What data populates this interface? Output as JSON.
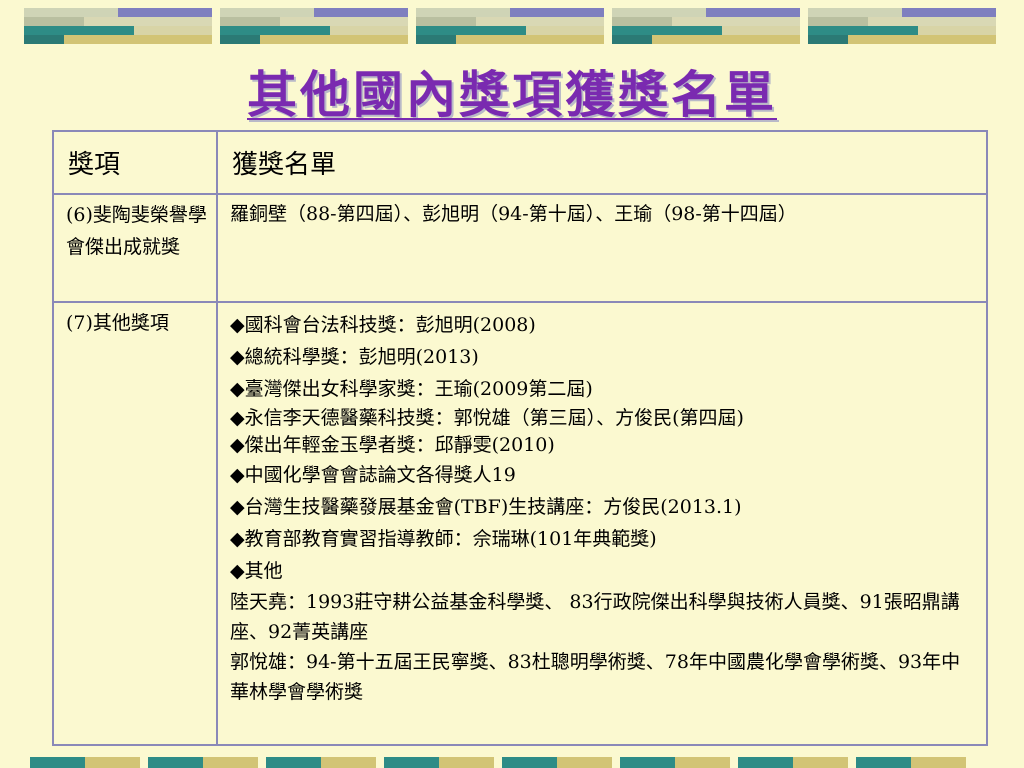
{
  "page_title": "其他國內獎項獲獎名單",
  "table": {
    "headers": [
      "獎項",
      "獲獎名單"
    ],
    "row6": {
      "award": "(6)斐陶斐榮譽學會傑出成就獎",
      "winners": "羅銅壁（88-第四屆）、彭旭明（94-第十屆）、王瑜（98-第十四屆）"
    },
    "row7": {
      "award": "(7)其他獎項",
      "items": [
        "◆國科會台法科技獎：彭旭明(2008)",
        "◆總統科學獎：彭旭明(2013)",
        "◆臺灣傑出女科學家獎：王瑜(2009第二屆)",
        "◆永信李天德醫藥科技獎：郭悅雄（第三屆）、方俊民(第四屆)",
        "◆傑出年輕金玉學者獎：邱靜雯(2010)",
        "◆中國化學會會誌論文各得獎人19",
        "◆台灣生技醫藥發展基金會(TBF)生技講座：方俊民(2013.1)",
        "◆教育部教育實習指導教師：佘瑞琳(101年典範獎)",
        "◆其他"
      ],
      "paragraphs": [
        "陸天堯：1993莊守耕公益基金科學獎、 83行政院傑出科學與技術人員獎、91張昭鼎講座、92菁英講座",
        "郭悅雄：94-第十五屆王民寧獎、83杜聰明學術獎、78年中國農化學會學術獎、93年中華林學會學術獎"
      ]
    }
  },
  "colors": {
    "background": "#fbf9d0",
    "title": "#7a2ab0",
    "table_border": "#8a89b8"
  }
}
